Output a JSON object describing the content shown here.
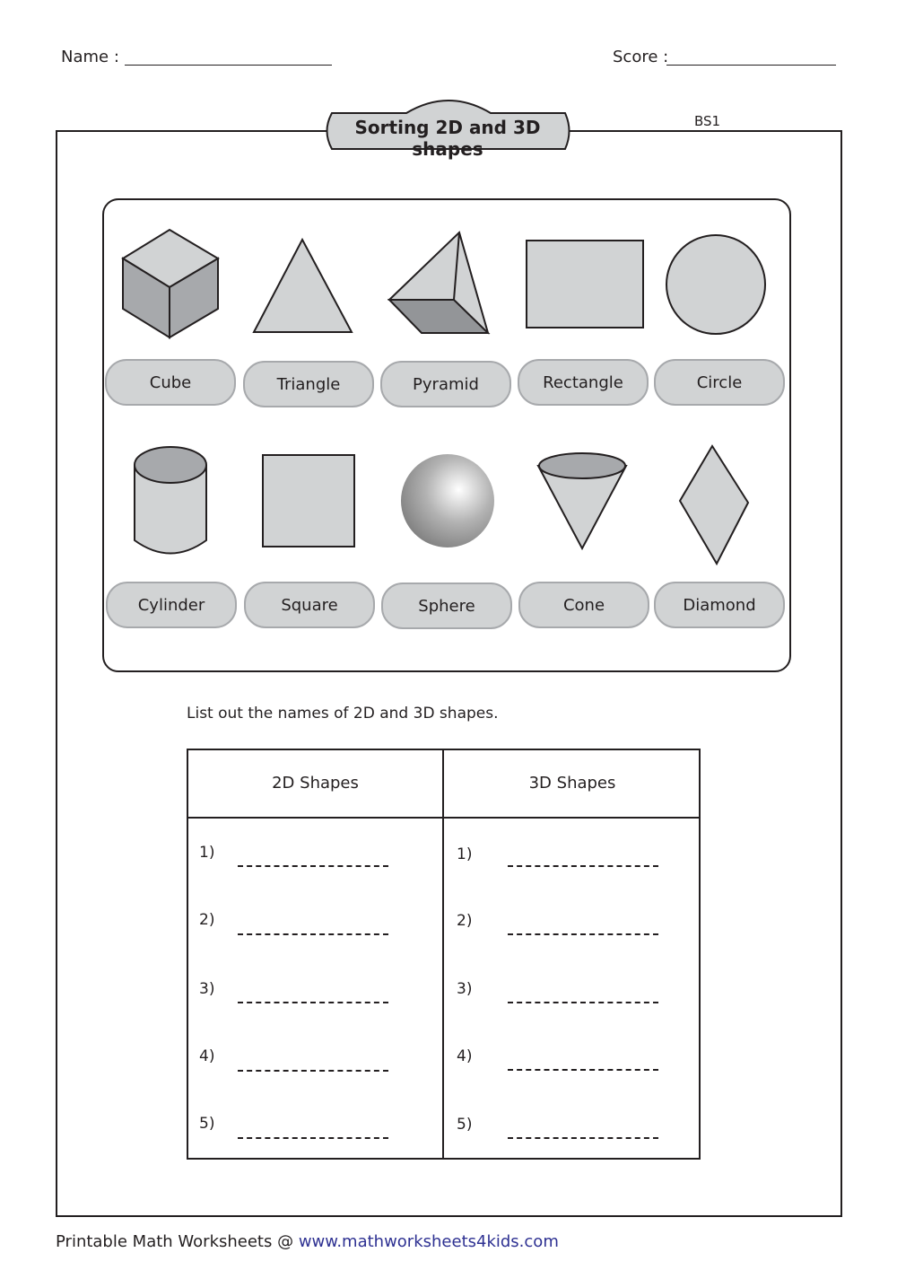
{
  "header": {
    "name_label": "Name :",
    "score_label": "Score :"
  },
  "worksheet": {
    "title": "Sorting 2D and 3D shapes",
    "code": "BS1",
    "shapes": [
      {
        "label": "Cube",
        "icon": "cube-icon"
      },
      {
        "label": "Triangle",
        "icon": "triangle-icon"
      },
      {
        "label": "Pyramid",
        "icon": "pyramid-icon"
      },
      {
        "label": "Rectangle",
        "icon": "rectangle-icon"
      },
      {
        "label": "Circle",
        "icon": "circle-icon"
      },
      {
        "label": "Cylinder",
        "icon": "cylinder-icon"
      },
      {
        "label": "Square",
        "icon": "square-icon"
      },
      {
        "label": "Sphere",
        "icon": "sphere-icon"
      },
      {
        "label": "Cone",
        "icon": "cone-icon"
      },
      {
        "label": "Diamond",
        "icon": "diamond-icon"
      }
    ],
    "instruction": "List out the names of 2D and 3D shapes.",
    "table": {
      "headers": [
        "2D Shapes",
        "3D Shapes"
      ],
      "row_numbers": [
        "1)",
        "2)",
        "3)",
        "4)",
        "5)"
      ]
    }
  },
  "footer": {
    "text": "Printable Math Worksheets @ ",
    "link": "www.mathworksheets4kids.com"
  },
  "colors": {
    "shape_fill": "#d1d3d4",
    "link": "#2e3192"
  }
}
